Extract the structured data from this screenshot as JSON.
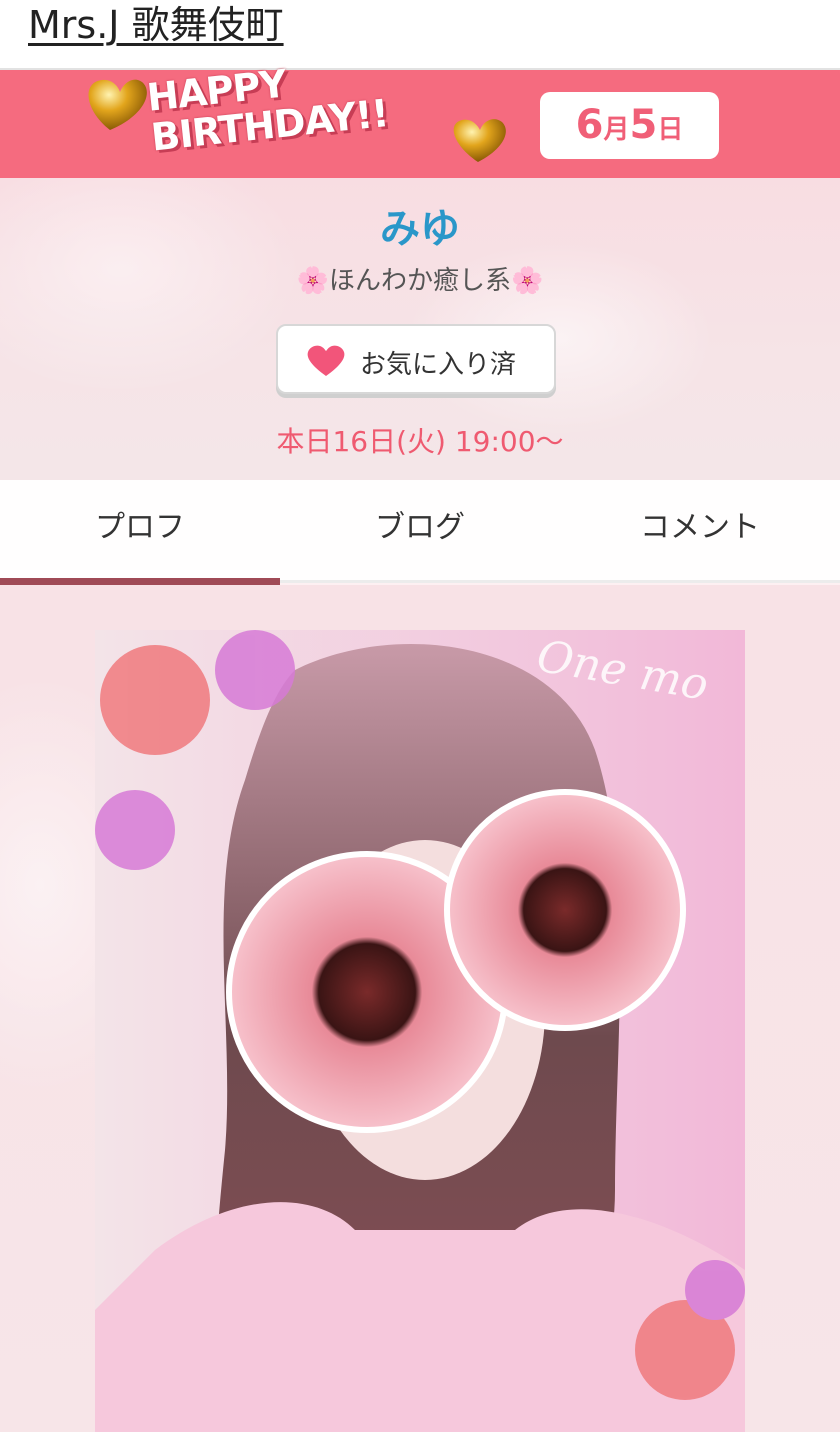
{
  "header": {
    "site_title": "Mrs.J 歌舞伎町"
  },
  "banner": {
    "line1": "HAPPY",
    "line2": "BIRTHDAY!!",
    "date_month": "6",
    "date_month_unit": "月",
    "date_day": "5",
    "date_day_unit": "日",
    "bg_color": "#f56b7f"
  },
  "profile": {
    "name": "みゆ",
    "catchphrase": "ほんわか癒し系",
    "flower_icon": "cherry-blossom-icon",
    "favorite_button_label": "お気に入り済",
    "favorite_icon": "heart-icon",
    "schedule": "本日16日(火) 19:00〜"
  },
  "tabs": [
    {
      "label": "プロフ",
      "active": true
    },
    {
      "label": "ブログ",
      "active": false
    },
    {
      "label": "コメント",
      "active": false
    }
  ],
  "photo": {
    "overlay_script": "One mo"
  },
  "colors": {
    "accent_pink": "#f56b7f",
    "name_blue": "#2a97c9",
    "schedule_red": "#ef5a70",
    "tab_indicator": "#a04a56"
  }
}
